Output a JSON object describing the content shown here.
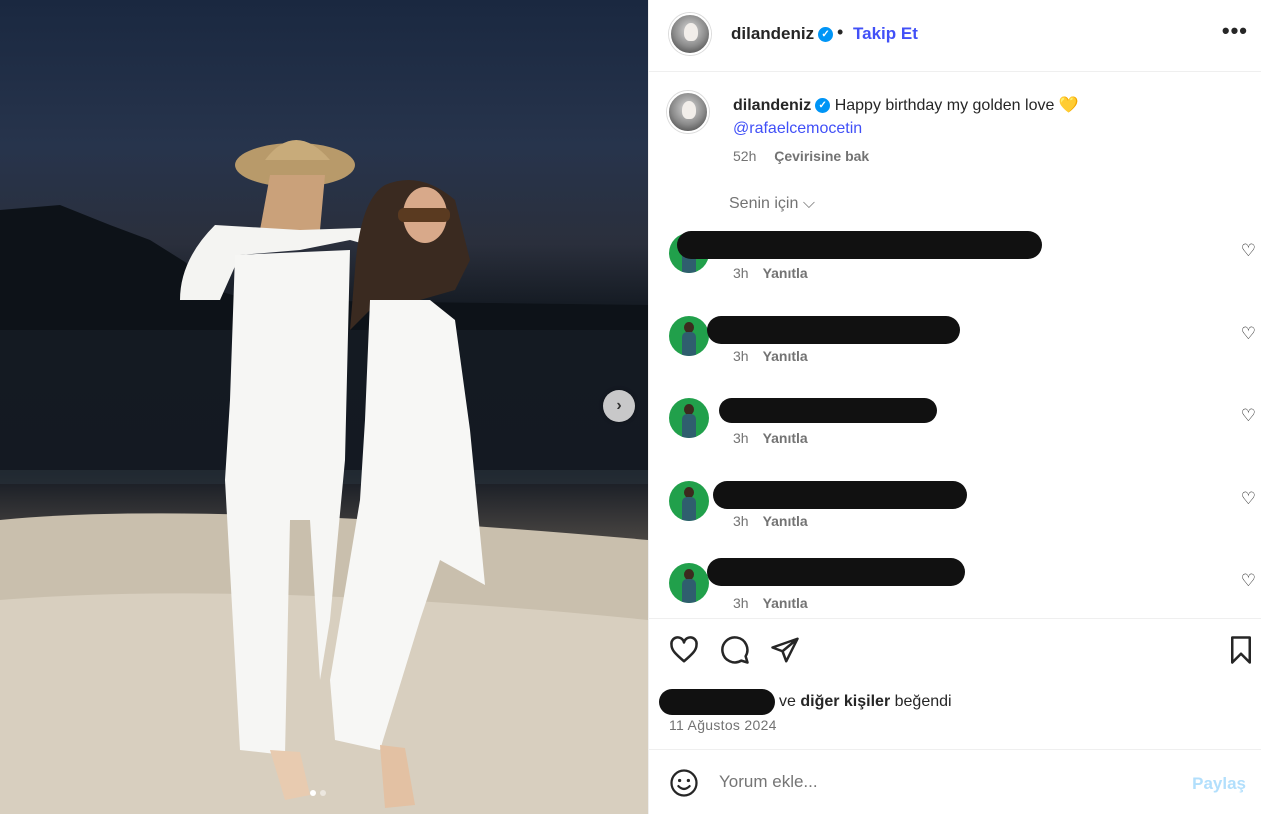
{
  "post": {
    "username": "dilandeniz",
    "follow_label": "Takip Et",
    "more_label": "•••",
    "separator": "•",
    "caption_text": "Happy birthday my golden love 💛",
    "mention": "@rafaelcemocetin",
    "time": "52h",
    "translate_label": "Çevirisine bak",
    "carousel": {
      "current": 1,
      "total": 2
    }
  },
  "comments": {
    "filter_label": "Senin için ⌵",
    "items": [
      {
        "time": "3h",
        "reply_label": "Yanıtla"
      },
      {
        "time": "3h",
        "reply_label": "Yanıtla"
      },
      {
        "time": "3h",
        "reply_label": "Yanıtla"
      },
      {
        "time": "3h",
        "reply_label": "Yanıtla"
      },
      {
        "time": "3h",
        "reply_label": "Yanıtla"
      }
    ]
  },
  "likes": {
    "middle": "ve ",
    "others": "diğer kişiler",
    "suffix": " beğendi",
    "date": "11 Ağustos 2024"
  },
  "composer": {
    "placeholder": "Yorum ekle...",
    "share_label": "Paylaş"
  },
  "icons": {
    "like": "heart-icon",
    "comment": "comment-icon",
    "share": "send-icon",
    "save": "bookmark-icon",
    "emoji": "emoji-icon",
    "next": "chevron-right-icon"
  },
  "colors": {
    "link": "#4150f7",
    "verified": "#0095f6",
    "muted": "#737373",
    "share_disabled": "#b2dffc"
  }
}
